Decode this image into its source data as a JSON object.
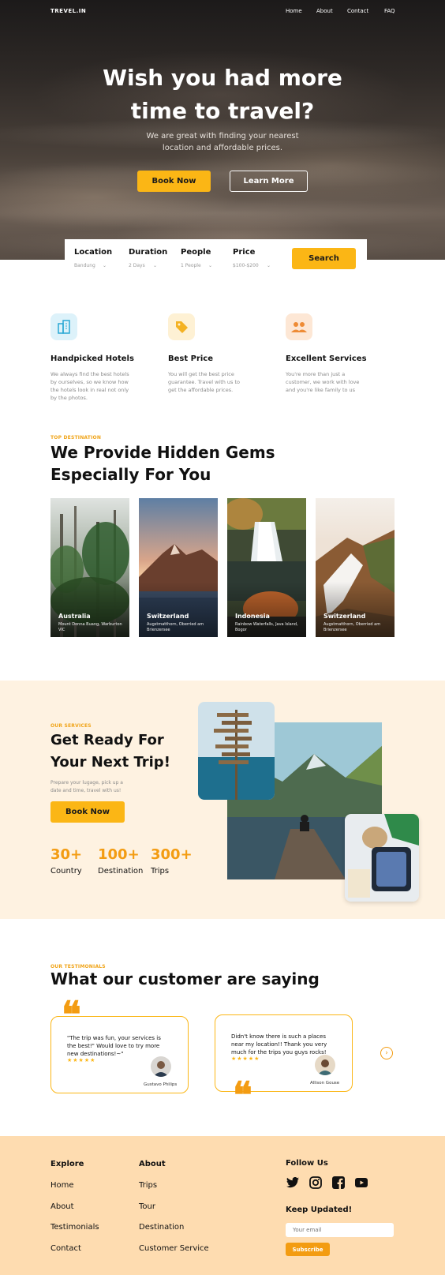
{
  "brand": "TREVEL.IN",
  "nav": [
    "Home",
    "About",
    "Contact",
    "FAQ"
  ],
  "hero": {
    "title_line1": "Wish you had more",
    "title_line2": "time to travel?",
    "subtitle_line1": "We are great with finding your nearest",
    "subtitle_line2": "location and affordable prices.",
    "book_label": "Book Now",
    "learn_label": "Learn More"
  },
  "search": {
    "fields": [
      {
        "label": "Location",
        "value": "Bandung"
      },
      {
        "label": "Duration",
        "value": "2 Days"
      },
      {
        "label": "People",
        "value": "1 People"
      },
      {
        "label": "Price",
        "value": "$100-$200"
      }
    ],
    "button": "Search"
  },
  "features": [
    {
      "icon": "building-icon",
      "title": "Handpicked Hotels",
      "desc": "We always find the best hotels by ourselves, so we know how the hotels look in real not only by the photos.",
      "bg": "#DDF2FA",
      "fg": "#29A8D4"
    },
    {
      "icon": "price-tag-icon",
      "title": "Best Price",
      "desc": "You will get the best price guarantee. Travel with us to get the affordable prices.",
      "bg": "#FEF1D4",
      "fg": "#F4B223"
    },
    {
      "icon": "people-icon",
      "title": "Excellent Services",
      "desc": "You're more than just a customer, we work with love and you're like family to us",
      "bg": "#FDE7D5",
      "fg": "#EE8B35"
    }
  ],
  "destinations": {
    "eyebrow": "TOP DESTINATION",
    "title_line1": "We Provide Hidden Gems",
    "title_line2": "Especially For You",
    "items": [
      {
        "name": "Australia",
        "sub": "Mount Donna Buang, Warburton VIC"
      },
      {
        "name": "Switzerland",
        "sub": "Augstmatthorn, Oberried am Brienzersee"
      },
      {
        "name": "Indonesia",
        "sub": "Rainbow Waterfalls, Java Island, Bogor"
      },
      {
        "name": "Switzerland",
        "sub": "Augstmatthorn, Oberried am Brienzersee"
      }
    ]
  },
  "services": {
    "eyebrow": "OUR SERVICES",
    "title_line1": "Get Ready For",
    "title_line2": "Your Next Trip!",
    "desc_line1": "Prepare your lugage, pick up a",
    "desc_line2": "date and time, travel with us!",
    "button": "Book Now",
    "stats": [
      {
        "num": "30+",
        "label": "Country"
      },
      {
        "num": "100+",
        "label": "Destination"
      },
      {
        "num": "300+",
        "label": "Trips"
      }
    ]
  },
  "testimonials": {
    "eyebrow": "OUR TESTIMONIALS",
    "title": "What our customer are saying",
    "items": [
      {
        "quote": "\"The trip was fun, your services is the best!\" Would love to try more new destinations!~\"",
        "stars": "★★★★★",
        "name": "Gustavo Philips"
      },
      {
        "quote": "Didn't know there is such a places near my location!! Thank you very much for the trips you guys rocks!",
        "stars": "★★★★★",
        "name": "Allison Gouse"
      }
    ],
    "quote_mark": "❝"
  },
  "footer": {
    "explore_head": "Explore",
    "explore": [
      "Home",
      "About",
      "Testimonials",
      "Contact"
    ],
    "about_head": "About",
    "about": [
      "Trips",
      "Tour",
      "Destination",
      "Customer Service"
    ],
    "follow_head": "Follow Us",
    "socials": [
      "twitter-icon",
      "instagram-icon",
      "facebook-icon",
      "youtube-icon"
    ],
    "updated_head": "Keep Updated!",
    "email_placeholder": "Your email",
    "subscribe": "Subscribe"
  },
  "colors": {
    "accent": "#FBB615",
    "orange": "#F39C12",
    "cream": "#FEF2E1",
    "footer": "#FEDCB0"
  }
}
